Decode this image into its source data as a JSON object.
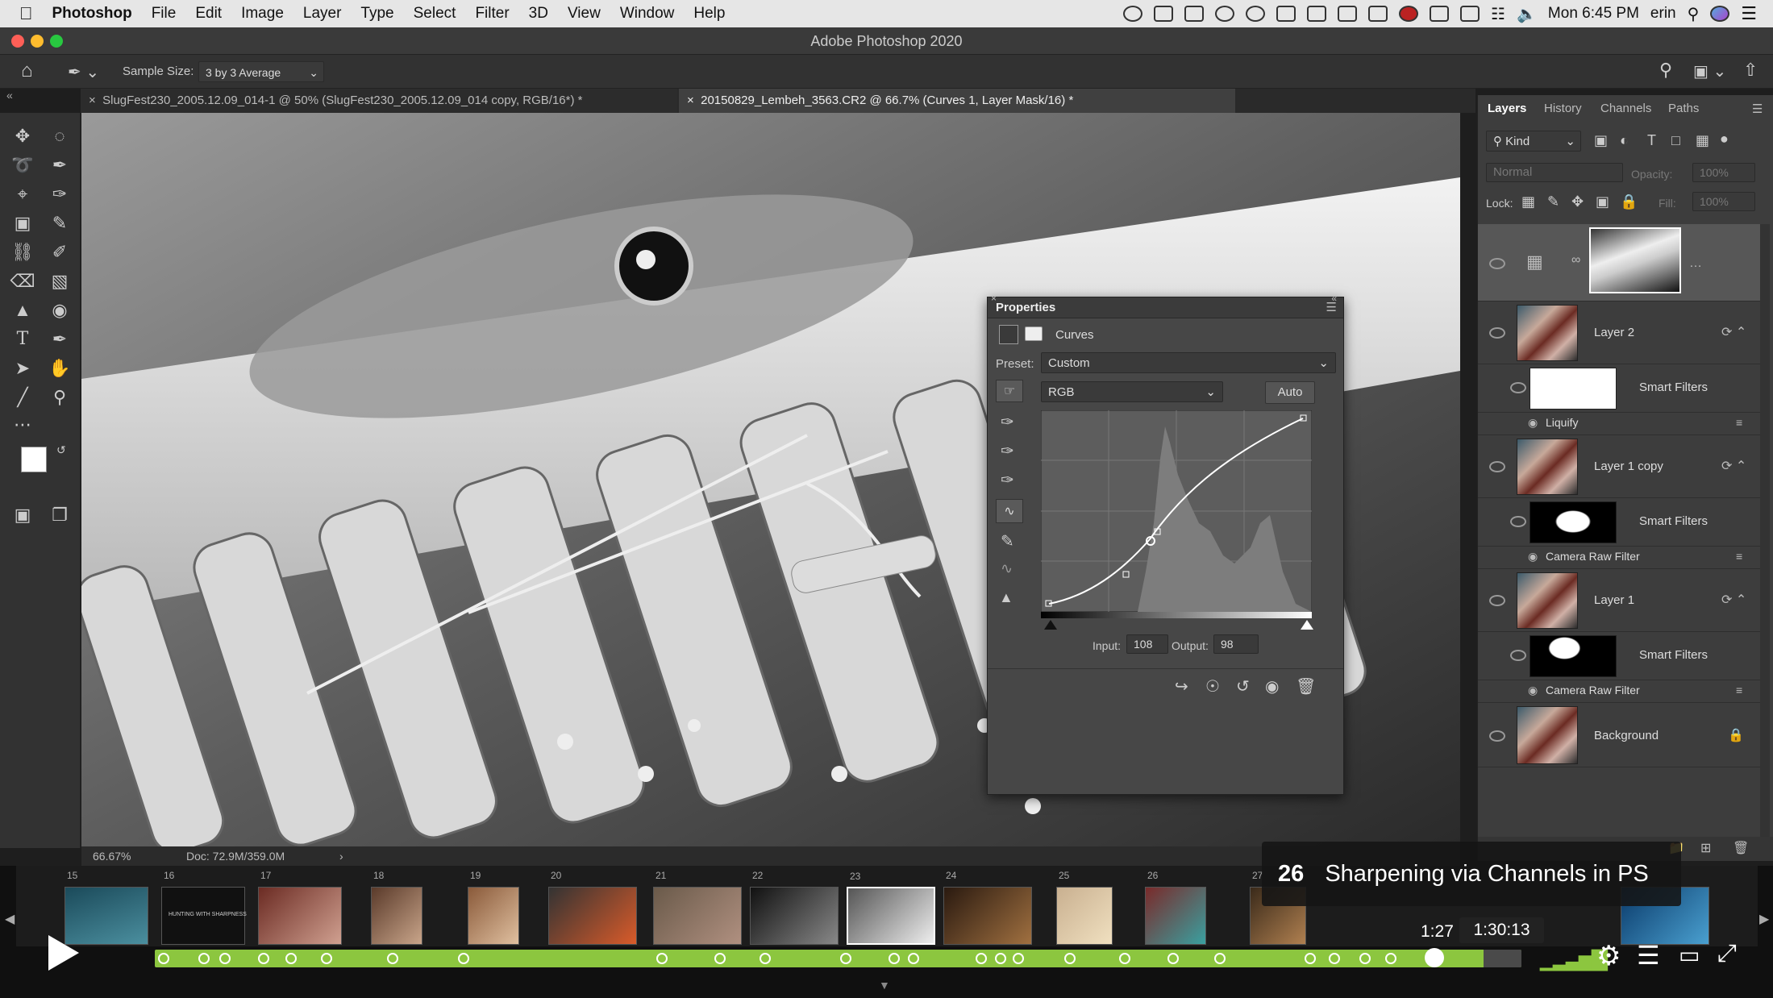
{
  "menubar": {
    "app": "Photoshop",
    "items": [
      "File",
      "Edit",
      "Image",
      "Layer",
      "Type",
      "Select",
      "Filter",
      "3D",
      "View",
      "Window",
      "Help"
    ],
    "clock": "Mon 6:45 PM",
    "user": "erin"
  },
  "window_title": "Adobe Photoshop 2020",
  "options_bar": {
    "sample_size_label": "Sample Size:",
    "sample_size_value": "3 by 3 Average"
  },
  "doc_tabs": [
    {
      "label": "SlugFest230_2005.12.09_014-1 @ 50% (SlugFest230_2005.12.09_014 copy, RGB/16*) *"
    },
    {
      "label": "20150829_Lembeh_3563.CR2 @ 66.7% (Curves 1, Layer Mask/16) *"
    }
  ],
  "status": {
    "zoom": "66.67%",
    "doc": "Doc: 72.9M/359.0M"
  },
  "properties": {
    "title": "Properties",
    "adjustment": "Curves",
    "preset_label": "Preset:",
    "preset_value": "Custom",
    "channel": "RGB",
    "auto_label": "Auto",
    "input_label": "Input:",
    "input_value": "108",
    "output_label": "Output:",
    "output_value": "98"
  },
  "layers_panel": {
    "tabs": [
      "Layers",
      "History",
      "Channels",
      "Paths"
    ],
    "kind_label": "Kind",
    "blend_mode": "Normal",
    "opacity_label": "Opacity:",
    "opacity_value": "100%",
    "lock_label": "Lock:",
    "fill_label": "Fill:",
    "fill_value": "100%",
    "layers": [
      {
        "name": "Layer 2",
        "smart": "Smart Filters",
        "filter": "Liquify"
      },
      {
        "name": "Layer 1 copy",
        "smart": "Smart Filters",
        "filter": "Camera Raw Filter"
      },
      {
        "name": "Layer 1",
        "smart": "Smart Filters",
        "filter": "Camera Raw Filter"
      },
      {
        "name": "Background"
      }
    ]
  },
  "player": {
    "chapter_number": "26",
    "chapter_title": "Sharpening via Channels in PS",
    "current_time": "1:27",
    "duration": "1:30:13",
    "progress_fraction": 0.972,
    "film_numbers": [
      "15",
      "16",
      "17",
      "18",
      "19",
      "20",
      "21",
      "22",
      "23",
      "24",
      "25",
      "26",
      "27"
    ],
    "film_caption": "HUNTING WITH SHARPNESS"
  },
  "colors": {
    "accent_green": "#8cc63f",
    "panel": "#3d3d3d",
    "menubar": "#e6e6e6"
  }
}
